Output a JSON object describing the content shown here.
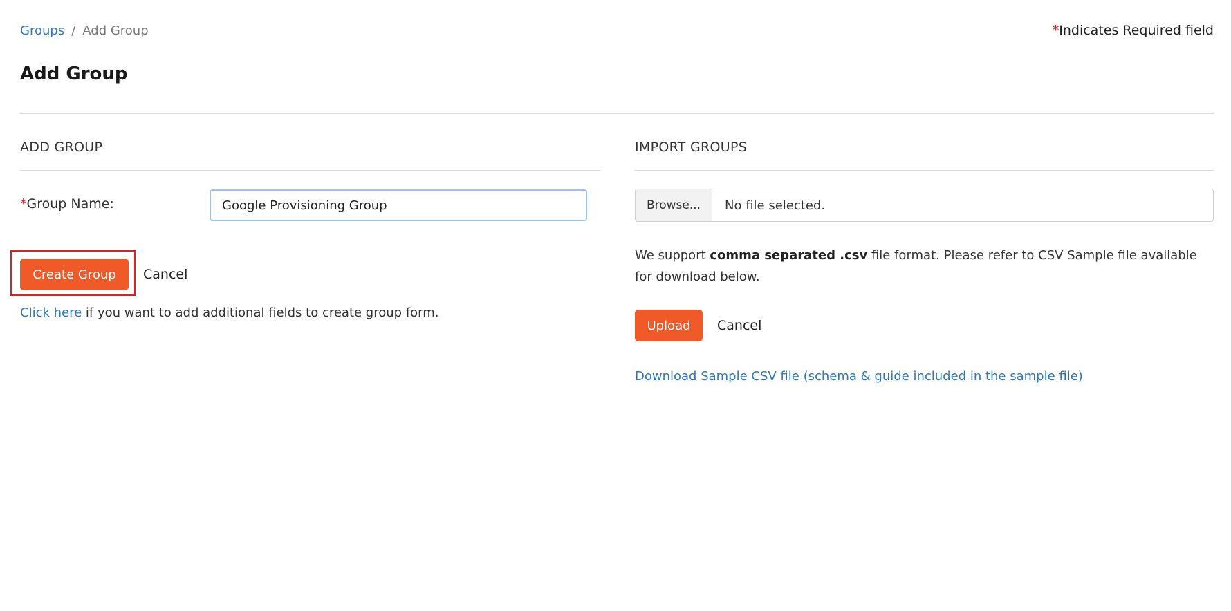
{
  "breadcrumb": {
    "parent": "Groups",
    "separator": "/",
    "current": "Add Group"
  },
  "required_note": {
    "asterisk": "*",
    "text": "Indicates Required field"
  },
  "page_title": "Add Group",
  "add_group": {
    "heading": "ADD GROUP",
    "field_label_asterisk": "*",
    "field_label": "Group Name:",
    "group_name_value": "Google Provisioning Group",
    "create_button": "Create Group",
    "cancel_label": "Cancel",
    "help_link": "Click here",
    "help_text": " if you want to add additional fields to create group form."
  },
  "import_groups": {
    "heading": "IMPORT GROUPS",
    "browse_button": "Browse...",
    "file_status": "No file selected.",
    "support_prefix": "We support ",
    "support_bold": "comma separated .csv",
    "support_suffix": " file format. Please refer to CSV Sample file available for download below.",
    "upload_button": "Upload",
    "cancel_label": "Cancel",
    "download_link": "Download Sample CSV file (schema & guide included in the sample file)"
  },
  "colors": {
    "accent": "#ef5a28",
    "link": "#2f79b8",
    "required": "#e02020",
    "input_focus_border": "#9cc3ea"
  }
}
